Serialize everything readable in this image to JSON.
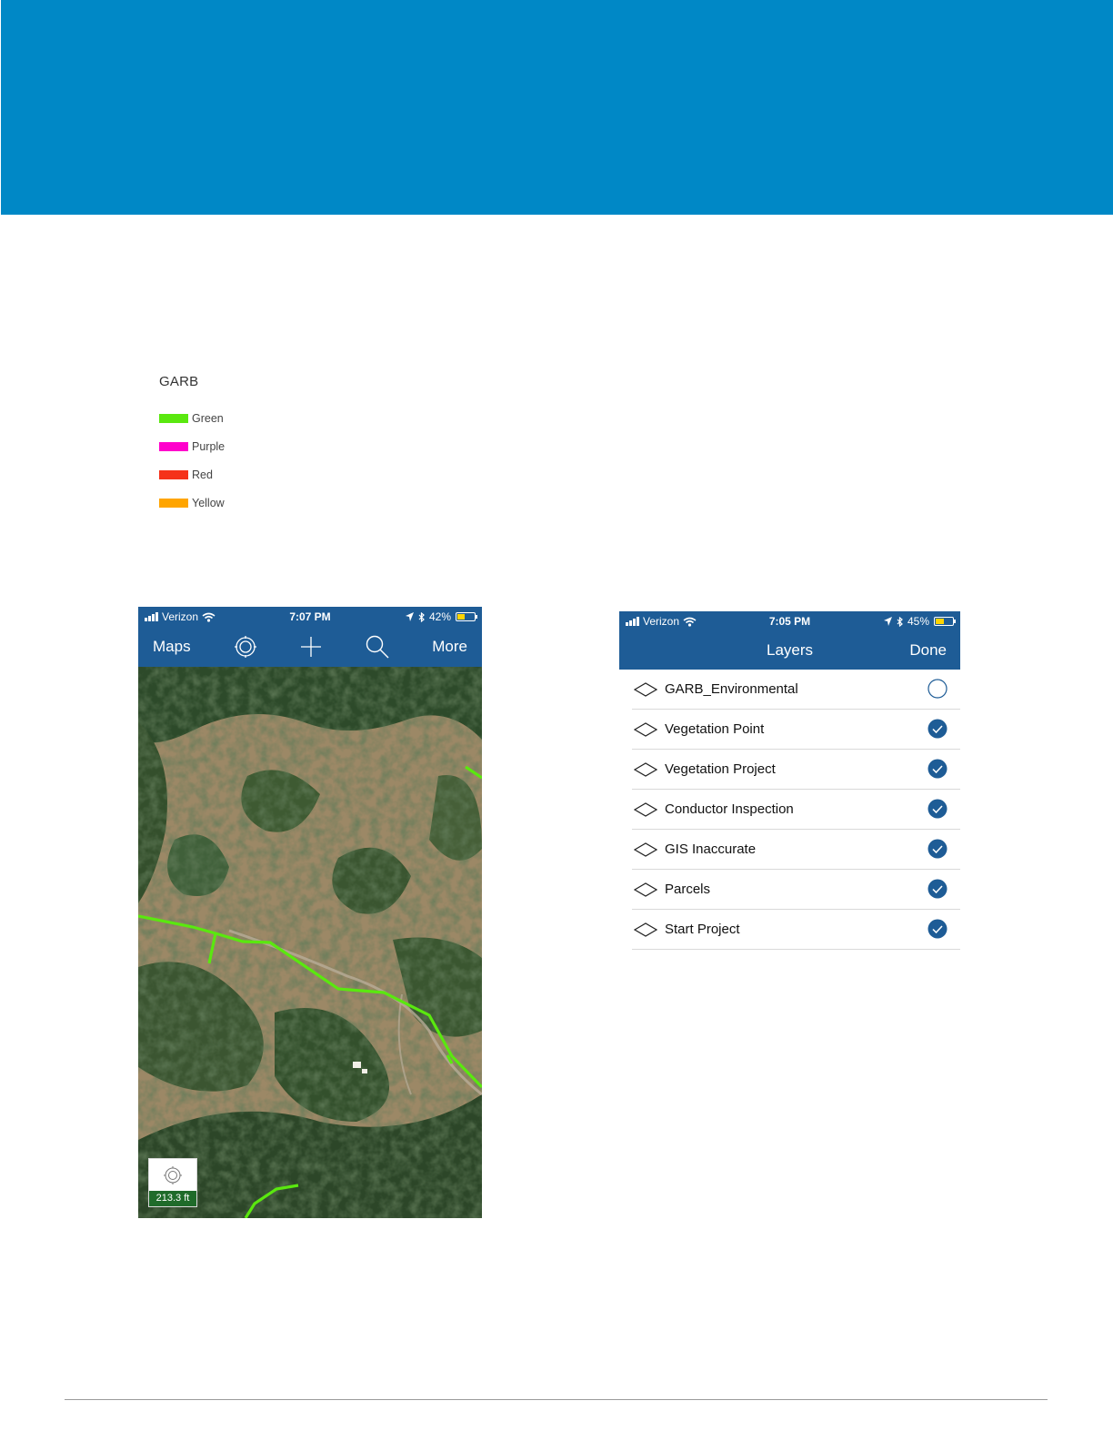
{
  "legend": {
    "title": "GARB",
    "items": [
      {
        "label": "Green",
        "color": "#5ae80f"
      },
      {
        "label": "Purple",
        "color": "#ff00cc"
      },
      {
        "label": "Red",
        "color": "#f5321a"
      },
      {
        "label": "Yellow",
        "color": "#ffa500"
      }
    ]
  },
  "map_phone": {
    "status": {
      "carrier": "Verizon",
      "time": "7:07 PM",
      "battery": "42%",
      "battery_level": 0.42
    },
    "nav": {
      "maps_label": "Maps",
      "more_label": "More",
      "icons": [
        "locate-icon",
        "add-icon",
        "search-icon"
      ]
    },
    "scale_label": "213.3 ft",
    "colors": {
      "nav_bg": "#1e5c96",
      "line": "#5ae80f",
      "scale_bg": "#1f6b2a"
    }
  },
  "layers_phone": {
    "status": {
      "carrier": "Verizon",
      "time": "7:05 PM",
      "battery": "45%",
      "battery_level": 0.45
    },
    "nav": {
      "title": "Layers",
      "done_label": "Done"
    },
    "layers": [
      {
        "name": "GARB_Environmental",
        "checked": false
      },
      {
        "name": "Vegetation Point",
        "checked": true
      },
      {
        "name": "Vegetation Project",
        "checked": true
      },
      {
        "name": "Conductor Inspection",
        "checked": true
      },
      {
        "name": "GIS Inaccurate",
        "checked": true
      },
      {
        "name": "Parcels",
        "checked": true
      },
      {
        "name": "Start Project",
        "checked": true
      }
    ],
    "colors": {
      "check": "#1e5c96"
    }
  },
  "colors": {
    "banner": "#0088c6",
    "footer_line": "#9a9a9a"
  }
}
